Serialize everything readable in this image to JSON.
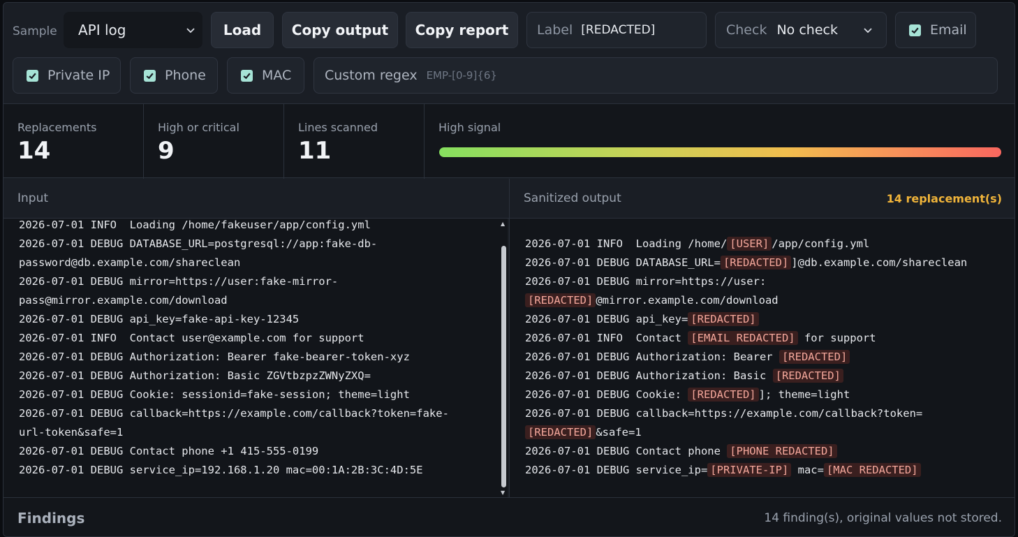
{
  "toolbar": {
    "sample_label": "Sample",
    "sample_value": "API log",
    "load": "Load",
    "copy_output": "Copy output",
    "copy_report": "Copy report",
    "label_caption": "Label",
    "label_value": "[REDACTED]",
    "check_caption": "Check",
    "check_value": "No check",
    "email": "Email",
    "private_ip": "Private IP",
    "phone": "Phone",
    "mac": "MAC",
    "custom_regex_caption": "Custom regex",
    "custom_regex_placeholder": "EMP-[0-9]{6}"
  },
  "stats": {
    "replacements_label": "Replacements",
    "replacements": "14",
    "high_label": "High or critical",
    "high": "9",
    "lines_label": "Lines scanned",
    "lines": "11",
    "signal_label": "High signal"
  },
  "input": {
    "title": "Input",
    "lines": [
      "2026-07-01 INFO  Loading /home/fakeuser/app/config.yml",
      "2026-07-01 DEBUG DATABASE_URL=postgresql://app:fake-db-",
      "password@db.example.com/shareclean",
      "2026-07-01 DEBUG mirror=https://user:fake-mirror-",
      "pass@mirror.example.com/download",
      "2026-07-01 DEBUG api_key=fake-api-key-12345",
      "2026-07-01 INFO  Contact user@example.com for support",
      "2026-07-01 DEBUG Authorization: Bearer fake-bearer-token-xyz",
      "2026-07-01 DEBUG Authorization: Basic ZGVtbzpzZWNyZXQ=",
      "2026-07-01 DEBUG Cookie: sessionid=fake-session; theme=light",
      "2026-07-01 DEBUG callback=https://example.com/callback?token=fake-",
      "url-token&safe=1",
      "2026-07-01 DEBUG Contact phone +1 415-555-0199",
      "2026-07-01 DEBUG service_ip=192.168.1.20 mac=00:1A:2B:3C:4D:5E"
    ]
  },
  "output": {
    "title": "Sanitized output",
    "count": "14 replacement(s)",
    "lines": [
      [
        {
          "t": "2026-07-01 INFO  Loading /home/"
        },
        {
          "r": "[USER]"
        },
        {
          "t": "/app/config.yml"
        }
      ],
      [
        {
          "t": "2026-07-01 DEBUG DATABASE_URL="
        },
        {
          "r": "[REDACTED]"
        },
        {
          "t": "]@db.example.com/shareclean"
        }
      ],
      [
        {
          "t": "2026-07-01 DEBUG mirror=https://user:"
        }
      ],
      [
        {
          "r": "[REDACTED]"
        },
        {
          "t": "@mirror.example.com/download"
        }
      ],
      [
        {
          "t": "2026-07-01 DEBUG api_key="
        },
        {
          "r": "[REDACTED]"
        }
      ],
      [
        {
          "t": "2026-07-01 INFO  Contact "
        },
        {
          "r": "[EMAIL REDACTED]"
        },
        {
          "t": " for support"
        }
      ],
      [
        {
          "t": "2026-07-01 DEBUG Authorization: Bearer "
        },
        {
          "r": "[REDACTED]"
        }
      ],
      [
        {
          "t": "2026-07-01 DEBUG Authorization: Basic "
        },
        {
          "r": "[REDACTED]"
        }
      ],
      [
        {
          "t": "2026-07-01 DEBUG Cookie: "
        },
        {
          "r": "[REDACTED]"
        },
        {
          "t": "]; theme=light"
        }
      ],
      [
        {
          "t": "2026-07-01 DEBUG callback=https://example.com/callback?token="
        }
      ],
      [
        {
          "r": "[REDACTED]"
        },
        {
          "t": "&safe=1"
        }
      ],
      [
        {
          "t": "2026-07-01 DEBUG Contact phone "
        },
        {
          "r": "[PHONE REDACTED]"
        }
      ],
      [
        {
          "t": "2026-07-01 DEBUG service_ip="
        },
        {
          "r": "[PRIVATE-IP]"
        },
        {
          "t": " mac="
        },
        {
          "r": "[MAC REDACTED]"
        }
      ]
    ]
  },
  "findings": {
    "title": "Findings",
    "note": "14 finding(s), original values not stored."
  },
  "colors": {
    "accent": "#f0b43a",
    "checkbox": "#a6e3d6",
    "token_text": "#f4a79b",
    "token_bg": "#3a1f1f"
  }
}
